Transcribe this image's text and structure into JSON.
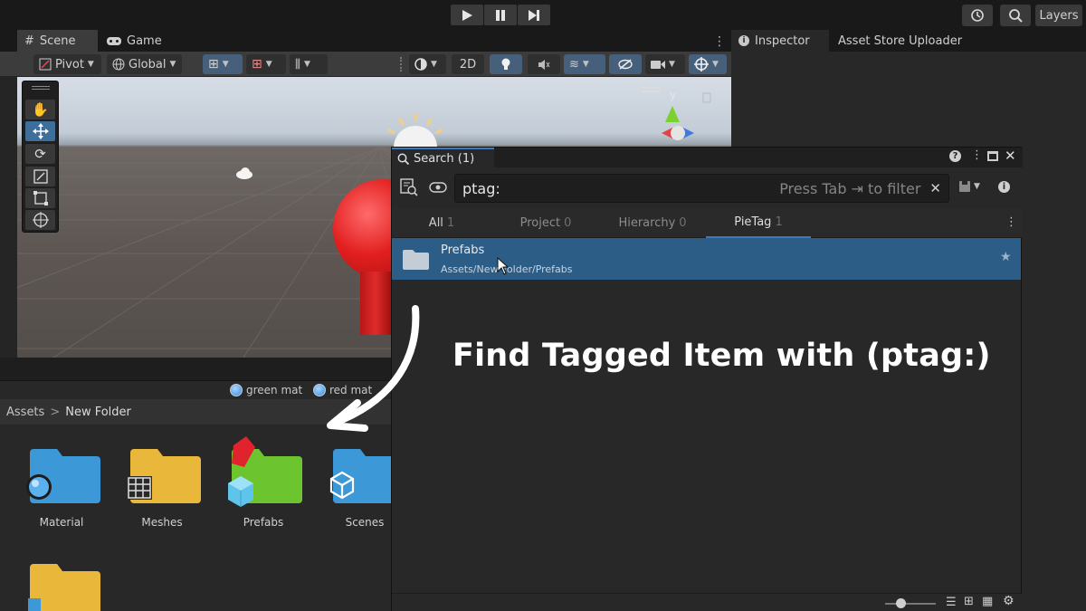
{
  "toolbar": {
    "play_icon": "play-icon",
    "pause_icon": "pause-icon",
    "step_icon": "step-icon",
    "layers_label": "Layers"
  },
  "scene_tabs": {
    "scene_label": "Scene",
    "game_label": "Game"
  },
  "scene_toolbar": {
    "pivot_label": "Pivot",
    "global_label": "Global",
    "mode_2d_label": "2D"
  },
  "gizmo": {
    "axis_label": "y"
  },
  "inspector_tabs": {
    "inspector_label": "Inspector",
    "asset_store_label": "Asset Store Uploader"
  },
  "project": {
    "materials": [
      "green mat",
      "red mat"
    ],
    "breadcrumb": {
      "root": "Assets",
      "separator": ">",
      "current": "New Folder"
    },
    "folders": [
      {
        "name": "Material",
        "color": "#3c98d6"
      },
      {
        "name": "Meshes",
        "color": "#e9b83a"
      },
      {
        "name": "Prefabs",
        "color": "#6cc52e"
      },
      {
        "name": "Scenes",
        "color": "#3c98d6"
      }
    ]
  },
  "search_window": {
    "title": "Search (1)",
    "query": "ptag:",
    "placeholder": "Press Tab ⇥ to filter",
    "tabs": [
      {
        "label": "All",
        "count": "1"
      },
      {
        "label": "Project",
        "count": "0"
      },
      {
        "label": "Hierarchy",
        "count": "0"
      },
      {
        "label": "PieTag",
        "count": "1"
      }
    ],
    "results": [
      {
        "title": "Prefabs",
        "path": "Assets/New Folder/Prefabs"
      }
    ]
  },
  "caption": "Find Tagged Item with (ptag:)",
  "colors": {
    "accent": "#3a79bb",
    "selection": "#2c5d87",
    "sphere": "#e21f1f"
  }
}
